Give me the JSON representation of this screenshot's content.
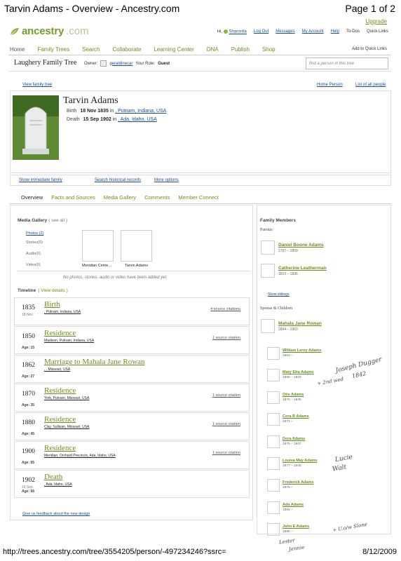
{
  "print_header": {
    "title": "Tarvin Adams - Overview - Ancestry.com",
    "page": "Page 1 of 2"
  },
  "upgrade": "Upgrade",
  "logo": {
    "word": "ancestry",
    "suffix": ".com",
    "icon": "leaf-icon"
  },
  "topnav": {
    "greeting": "Hi,",
    "user": "Sharonlla",
    "items": [
      "Log Out",
      "Messages",
      "My Account",
      "Help",
      "To-Dos",
      "Quick Links"
    ]
  },
  "mainnav": {
    "items": [
      "Home",
      "Family Trees",
      "Search",
      "Collaborate",
      "Learning Center",
      "DNA",
      "Publish",
      "Shop"
    ],
    "quick_links": "Add to Quick Links"
  },
  "tree": {
    "name": "Laughery Family Tree",
    "owner_label": "Owner:",
    "owner": "geraldinecar",
    "role_label": "Your Role:",
    "role": "Guest",
    "find_placeholder": "find a person in this tree"
  },
  "subnav": {
    "view_tree": "View family tree",
    "home_person": "Home Person",
    "list_people": "List of all people"
  },
  "person": {
    "name": "Tarvin Adams",
    "birth_label": "Birth",
    "birth_date": "18 Nov 1835",
    "birth_in": "in",
    "birth_place": ", Putnam, Indiana, USA",
    "death_label": "Death",
    "death_date": "15 Sep 1902",
    "death_in": "in",
    "death_place": ", Ada, Idaho, USA"
  },
  "actions": {
    "immediate": "Show immediate family",
    "historical": "Search historical records",
    "more": "More options"
  },
  "tabs": [
    "Overview",
    "Facts and Sources",
    "Media Gallery",
    "Comments",
    "Member Connect"
  ],
  "media": {
    "title": "Media Gallery",
    "see_all": "( see all )",
    "items": [
      "Photos (2)",
      "Stories(0)",
      "Audio(0)",
      "Video(0)"
    ],
    "thumbs": [
      "Meridian Ceme...",
      "Tarvin Adams"
    ],
    "note": "No photos, stories, audio or video have been added yet."
  },
  "timeline": {
    "title": "Timeline",
    "view": "( View details )",
    "events": [
      {
        "year": "1835",
        "date": "18 Nov",
        "age": "",
        "type": "Birth",
        "place": ", Putnam, Indiana, USA",
        "cite": "4 source citations"
      },
      {
        "year": "1850",
        "date": "",
        "age": "Age: 15",
        "type": "Residence",
        "place": "Madison, Putnam, Indiana, USA",
        "cite": "1 source citation"
      },
      {
        "year": "1862",
        "date": "",
        "age": "Age: 27",
        "type": "Marriage to Mahala Jane Rowan",
        "place": ", , Missouri, USA",
        "cite": ""
      },
      {
        "year": "1870",
        "date": "",
        "age": "Age: 35",
        "type": "Residence",
        "place": "York, Putnam, Missouri, USA",
        "cite": "1 source citation"
      },
      {
        "year": "1880",
        "date": "",
        "age": "Age: 45",
        "type": "Residence",
        "place": "Clay, Sullivan, Missouri, USA",
        "cite": "1 source citation"
      },
      {
        "year": "1900",
        "date": "",
        "age": "Age: 65",
        "type": "Residence",
        "place": "Meridian, Orchard Precincts, Ada, Idaho, USA",
        "cite": "1 source citation"
      },
      {
        "year": "1902",
        "date": "15 Sep",
        "age": "Age: 66",
        "type": "Death",
        "place": ", Ada, Idaho, USA",
        "cite": ""
      }
    ],
    "feedback": "Give us feedback about the new design"
  },
  "family": {
    "title": "Family Members",
    "parents_label": "Parents",
    "parents": [
      {
        "name": "Daniel Boone Adams",
        "dates": "1797 – 1859"
      },
      {
        "name": "Catherine Leatherman",
        "dates": "1810 – 1836"
      }
    ],
    "siblings": "Show siblings",
    "spouse_label": "Spouse & Children",
    "spouse": {
      "name": "Mahala Jane Rowan",
      "dates": "1844 – 1903"
    },
    "children": [
      {
        "name": "William Leroy Adams",
        "dates": "1863 –"
      },
      {
        "name": "Mary Etta Adams",
        "dates": "1866 – 1933"
      },
      {
        "name": "Otis Adams",
        "dates": "1870 – 1936"
      },
      {
        "name": "Cora B Adams",
        "dates": "1872 –"
      },
      {
        "name": "Dora Adams",
        "dates": "1875 – 1937"
      },
      {
        "name": "Louisa May Adams",
        "dates": "1877 – 1948"
      },
      {
        "name": "Frederick Adams",
        "dates": "1879 –"
      },
      {
        "name": "Ada Adams",
        "dates": "1883 –"
      },
      {
        "name": "John E Adams",
        "dates": "1885 –"
      }
    ]
  },
  "handwriting": [
    "Joseph Dugger",
    "1842",
    "+ 2nd wed",
    "Lucie",
    "Walt",
    "+ U.o/w Slone",
    "Lester",
    "Jennie"
  ],
  "footer": {
    "url": "http://trees.ancestry.com/tree/3554205/person/-497234246?ssrc=",
    "date": "8/12/2009"
  }
}
